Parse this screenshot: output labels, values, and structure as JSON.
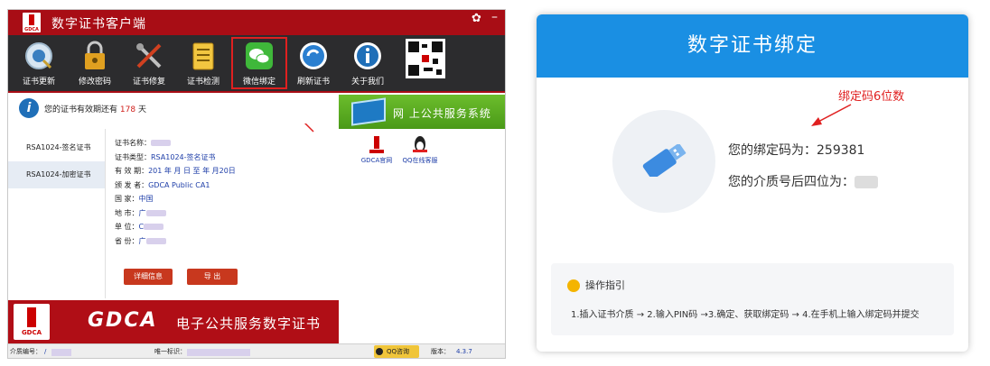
{
  "left_app": {
    "title": "数字证书客户端",
    "logo_text": "GDCA",
    "window": {
      "settings_glyph": "✿",
      "minimize_glyph": "–"
    },
    "toolbar": [
      {
        "label": "证书更新",
        "icon": "certificate-update-icon"
      },
      {
        "label": "修改密码",
        "icon": "lock-icon"
      },
      {
        "label": "证书修复",
        "icon": "repair-tools-icon"
      },
      {
        "label": "证书检测",
        "icon": "checklist-icon"
      },
      {
        "label": "微信绑定",
        "icon": "wechat-icon",
        "active": true
      },
      {
        "label": "刷新证书",
        "icon": "refresh-icon"
      },
      {
        "label": "关于我们",
        "icon": "info-icon"
      }
    ],
    "validity": {
      "prefix": "您的证书有效期还有",
      "days": "178",
      "suffix": "天"
    },
    "banner_text": "网 上公共服务系统",
    "certs": [
      {
        "name": "RSA1024-签名证书",
        "selected": false
      },
      {
        "name": "RSA1024-加密证书",
        "selected": true
      }
    ],
    "details": [
      {
        "label": "证书名称：",
        "value": ""
      },
      {
        "label": "证书类型：",
        "value": "RSA1024-签名证书"
      },
      {
        "label": "有 效 期：",
        "value": "201 年  月  日 至   年  月20日"
      },
      {
        "label": "颁 发 者：",
        "value": "GDCA Public CA1"
      },
      {
        "label": "国      家：",
        "value": "中国"
      },
      {
        "label": "地      市：",
        "value": "广"
      },
      {
        "label": "单      位：",
        "value": "C"
      },
      {
        "label": "省      份：",
        "value": "广"
      }
    ],
    "buttons": {
      "detail": "详细信息",
      "export": "导  出"
    },
    "links": [
      {
        "label": "GDCA官网",
        "icon": "gdca-logo-icon"
      },
      {
        "label": "QQ在线客服",
        "icon": "qq-penguin-icon"
      }
    ],
    "footer": {
      "brand": "GDCA",
      "slogan": "电子公共服务数字证书",
      "logo_text": "GDCA"
    },
    "statusbar": {
      "medium_label": "介质编号：",
      "medium_value": "/",
      "uid_label": "唯一标识：",
      "qq_label": "QQ咨询",
      "version_label": "版本：",
      "version_value": "4.3.7"
    }
  },
  "right_panel": {
    "title": "数字证书绑定",
    "annotation": "绑定码6位数",
    "bind_code_label": "您的绑定码为：",
    "bind_code_value": "259381",
    "media_last_label": "您的介质号后四位为：",
    "guide": {
      "title": "操作指引",
      "steps": "1.插入证书介质 → 2.输入PIN码 →3.确定、获取绑定码 → 4.在手机上输入绑定码并提交"
    }
  },
  "colors": {
    "titlebar": "#a80d15",
    "toolbar_bg": "#2c2c2e",
    "accent_blue": "#1a8fe3",
    "annotation_red": "#e02020",
    "banner_green": "#5aa820"
  }
}
